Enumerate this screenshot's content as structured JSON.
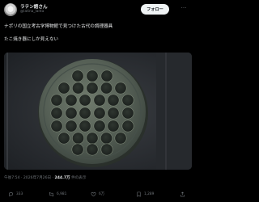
{
  "user": {
    "name": "ラテン語さん",
    "handle": "@latina_lanta"
  },
  "follow_label": "フォロー",
  "tweet": {
    "line1": "ナポリの国立考古学博物館で見つけた古代の調理器具",
    "line2": "たこ焼き器にしか見えない"
  },
  "meta": {
    "time": "午後7:54 · 2026年7月26日 · ",
    "views_count": "244.7万",
    "views_label": " 件の表示"
  },
  "actions": {
    "reply": "333",
    "retweet": "6,981",
    "like": "6万",
    "bookmark": "1,289"
  },
  "icons": {
    "more": "more-icon",
    "reply": "reply-icon",
    "retweet": "retweet-icon",
    "like": "heart-icon",
    "bookmark": "bookmark-icon",
    "share": "share-icon"
  },
  "colors": {
    "background": "#000000",
    "text": "#e7e9ea",
    "muted": "#71767b",
    "follow_bg": "#eff3f4"
  }
}
